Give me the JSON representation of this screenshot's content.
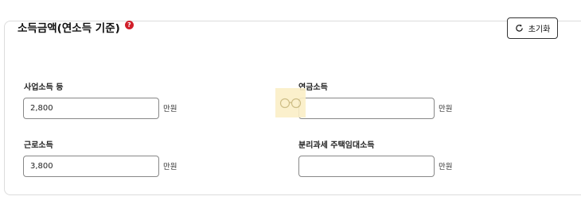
{
  "section": {
    "title": "소득금액(연소득 기준)",
    "help_badge": "?",
    "reset_label": "초기화"
  },
  "fields": [
    {
      "label": "사업소득 등",
      "value": "2,800",
      "unit": "만원"
    },
    {
      "label": "연금소득",
      "value": "",
      "unit": "만원"
    },
    {
      "label": "근로소득",
      "value": "3,800",
      "unit": "만원"
    },
    {
      "label": "분리과세 주택임대소득",
      "value": "",
      "unit": "만원"
    }
  ],
  "icons": {
    "reset": "refresh-icon",
    "help": "question-circle-icon",
    "watermark": "glasses-logo-icon"
  },
  "colors": {
    "help_badge": "#d11f2a",
    "border": "#dcdcdc",
    "input_border": "#888888"
  }
}
